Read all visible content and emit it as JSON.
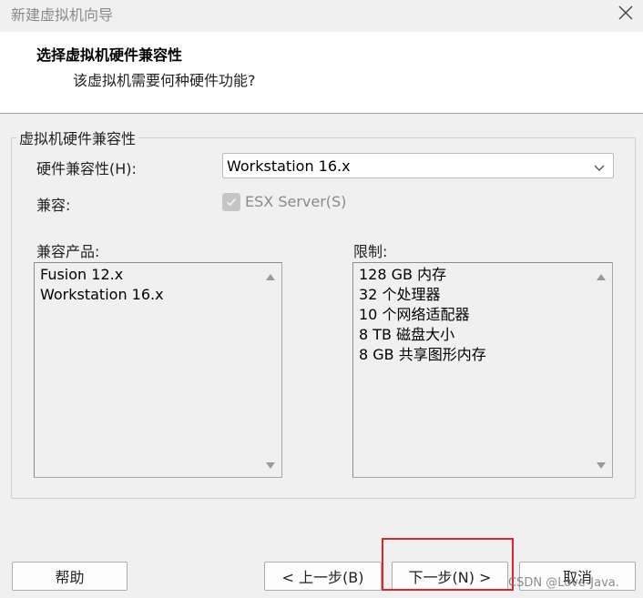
{
  "window": {
    "title": "新建虚拟机向导",
    "close_icon": "close-icon"
  },
  "header": {
    "title": "选择虚拟机硬件兼容性",
    "subtitle": "该虚拟机需要何种硬件功能?"
  },
  "group": {
    "legend": "虚拟机硬件兼容性",
    "hardware_label": "硬件兼容性(H):",
    "hardware_value": "Workstation 16.x",
    "compatible_label": "兼容:",
    "esx_label": "ESX Server(S)",
    "esx_checked": true,
    "products_label": "兼容产品:",
    "products": [
      "Fusion 12.x",
      "Workstation 16.x"
    ],
    "limits_label": "限制:",
    "limits": [
      "128 GB 内存",
      "32 个处理器",
      "10 个网络适配器",
      "8 TB 磁盘大小",
      "8 GB 共享图形内存"
    ]
  },
  "buttons": {
    "help": "帮助",
    "back": "< 上一步(B)",
    "next": "下一步(N) >",
    "cancel": "取消"
  },
  "watermark": "CSDN @Love-Java.",
  "colors": {
    "highlight": "#e0252a",
    "panel": "#f0f0f0",
    "header_bg": "#ffffff"
  }
}
